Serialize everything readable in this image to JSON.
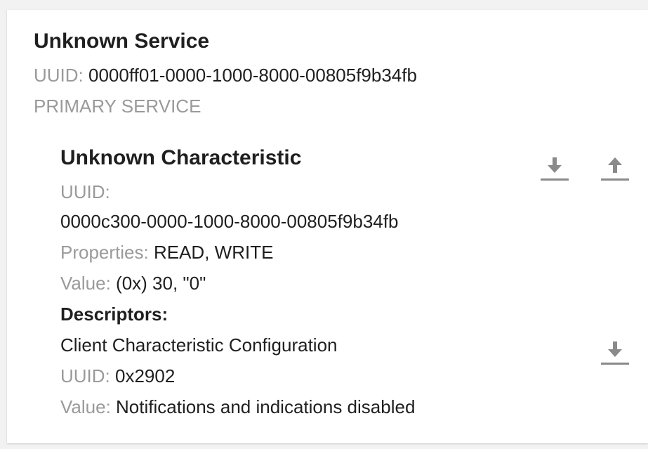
{
  "service": {
    "title": "Unknown Service",
    "uuid_label": "UUID:",
    "uuid_value": "0000ff01-0000-1000-8000-00805f9b34fb",
    "type": "PRIMARY SERVICE"
  },
  "characteristic": {
    "title": "Unknown Characteristic",
    "uuid_label": "UUID:",
    "uuid_value": "0000c300-0000-1000-8000-00805f9b34fb",
    "properties_label": "Properties:",
    "properties_value": "READ, WRITE",
    "value_label": "Value:",
    "value_value": "(0x) 30, \"0\"",
    "read_icon": "download-arrow-icon",
    "write_icon": "upload-arrow-icon"
  },
  "descriptors": {
    "heading": "Descriptors:",
    "items": [
      {
        "name": "Client Characteristic Configuration",
        "uuid_label": "UUID:",
        "uuid_value": "0x2902",
        "value_label": "Value:",
        "value_value": "Notifications and indications disabled",
        "read_icon": "download-arrow-icon"
      }
    ]
  },
  "colors": {
    "icon": "#8a8a8a",
    "label": "#9a9a9a",
    "text": "#1f1f1f"
  }
}
